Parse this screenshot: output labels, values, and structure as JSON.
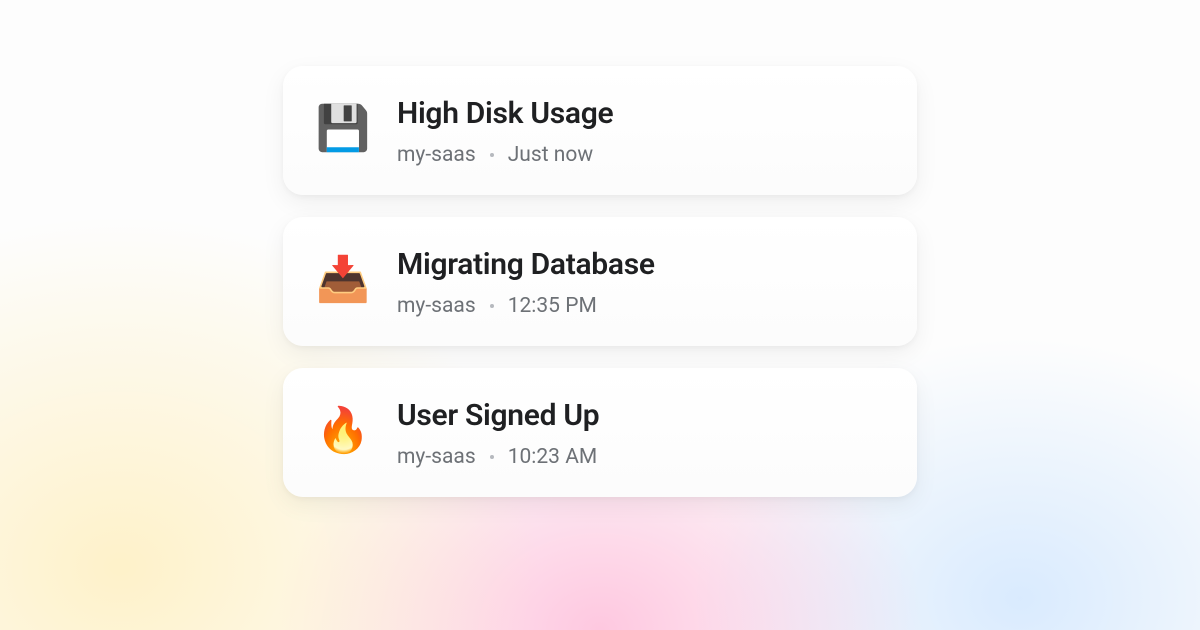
{
  "notifications": [
    {
      "icon": "💾",
      "icon_name": "floppy-disk-icon",
      "title": "High Disk Usage",
      "project": "my-saas",
      "time": "Just now"
    },
    {
      "icon": "📥",
      "icon_name": "inbox-download-icon",
      "title": "Migrating Database",
      "project": "my-saas",
      "time": "12:35 PM"
    },
    {
      "icon": "🔥",
      "icon_name": "fire-icon",
      "title": "User Signed Up",
      "project": "my-saas",
      "time": "10:23 AM"
    }
  ]
}
